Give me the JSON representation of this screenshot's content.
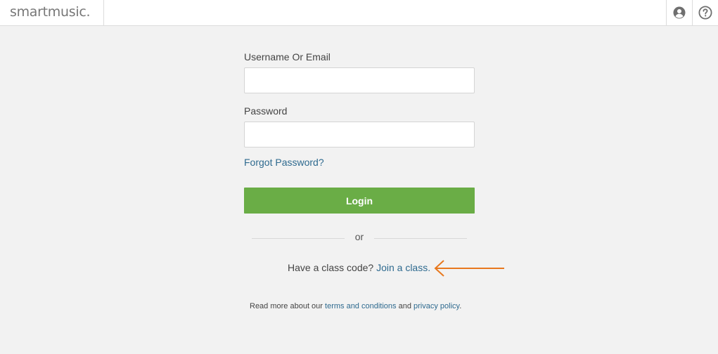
{
  "header": {
    "logo_text": "smartmusic",
    "logo_dot": ".",
    "user_icon": "user-circle-icon",
    "help_icon": "help-circle-icon"
  },
  "login_form": {
    "username_label": "Username Or Email",
    "username_value": "",
    "password_label": "Password",
    "password_value": "",
    "forgot_link": "Forgot Password?",
    "login_button": "Login",
    "divider_text": "or",
    "class_code_prompt": "Have a class code?",
    "join_class_link": "Join a class.",
    "legal_prefix": "Read more about our",
    "terms_link": "terms and conditions",
    "legal_and": "and",
    "privacy_link": "privacy policy",
    "legal_suffix": "."
  },
  "colors": {
    "accent_green": "#6aad46",
    "link_blue": "#2e6a8f",
    "annotation_orange": "#e8781e",
    "background": "#f2f2f2"
  },
  "annotation": {
    "icon": "arrow-left-icon"
  }
}
